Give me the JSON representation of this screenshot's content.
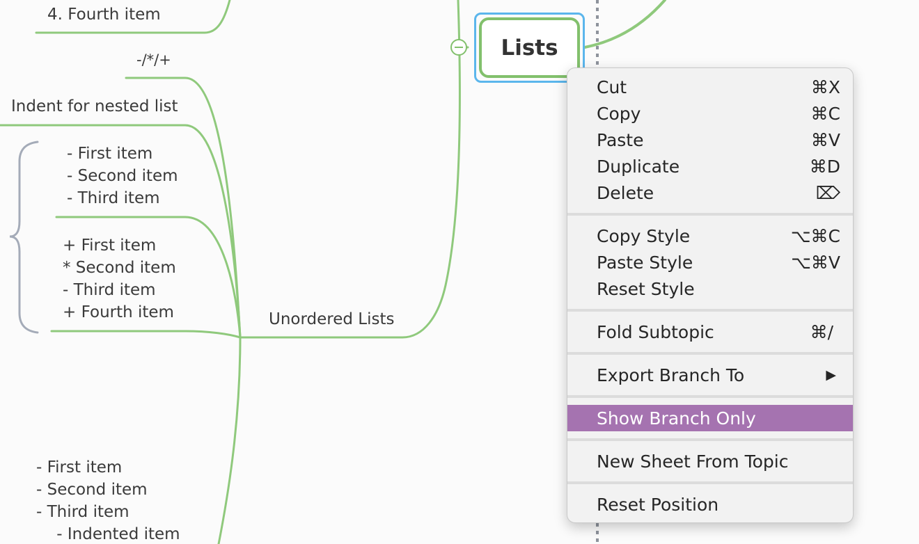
{
  "mindmap": {
    "central_topic": "Lists",
    "labels": {
      "fourth_item": "4. Fourth item",
      "bullets": "-/*/+",
      "indent_note": "Indent for nested list",
      "unordered_lists": "Unordered Lists"
    },
    "list_group_1": [
      "- First item",
      "- Second item",
      "- Third item"
    ],
    "list_group_2": [
      "+ First item",
      "* Second item",
      "- Third item",
      "+ Fourth item"
    ],
    "list_group_3": [
      "- First item",
      "- Second item",
      "- Third item",
      "    - Indented item"
    ],
    "colors": {
      "branch": "#8fc97c",
      "selection": "#5bb6ec",
      "bracket": "#a4abb8"
    }
  },
  "context_menu": {
    "groups": [
      [
        {
          "label": "Cut",
          "shortcut": "⌘X"
        },
        {
          "label": "Copy",
          "shortcut": "⌘C"
        },
        {
          "label": "Paste",
          "shortcut": "⌘V"
        },
        {
          "label": "Duplicate",
          "shortcut": "⌘D"
        },
        {
          "label": "Delete",
          "shortcut": "⌦"
        }
      ],
      [
        {
          "label": "Copy Style",
          "shortcut": "⌥⌘C"
        },
        {
          "label": "Paste Style",
          "shortcut": "⌥⌘V"
        },
        {
          "label": "Reset Style",
          "shortcut": ""
        }
      ],
      [
        {
          "label": "Fold Subtopic",
          "shortcut": "⌘/"
        }
      ],
      [
        {
          "label": "Export Branch To",
          "shortcut": "▶"
        }
      ],
      [
        {
          "label": "Show Branch Only",
          "shortcut": "",
          "highlighted": true
        }
      ],
      [
        {
          "label": "New Sheet From Topic",
          "shortcut": ""
        }
      ],
      [
        {
          "label": "Reset Position",
          "shortcut": ""
        }
      ]
    ],
    "highlight_color": "#a573b0"
  }
}
